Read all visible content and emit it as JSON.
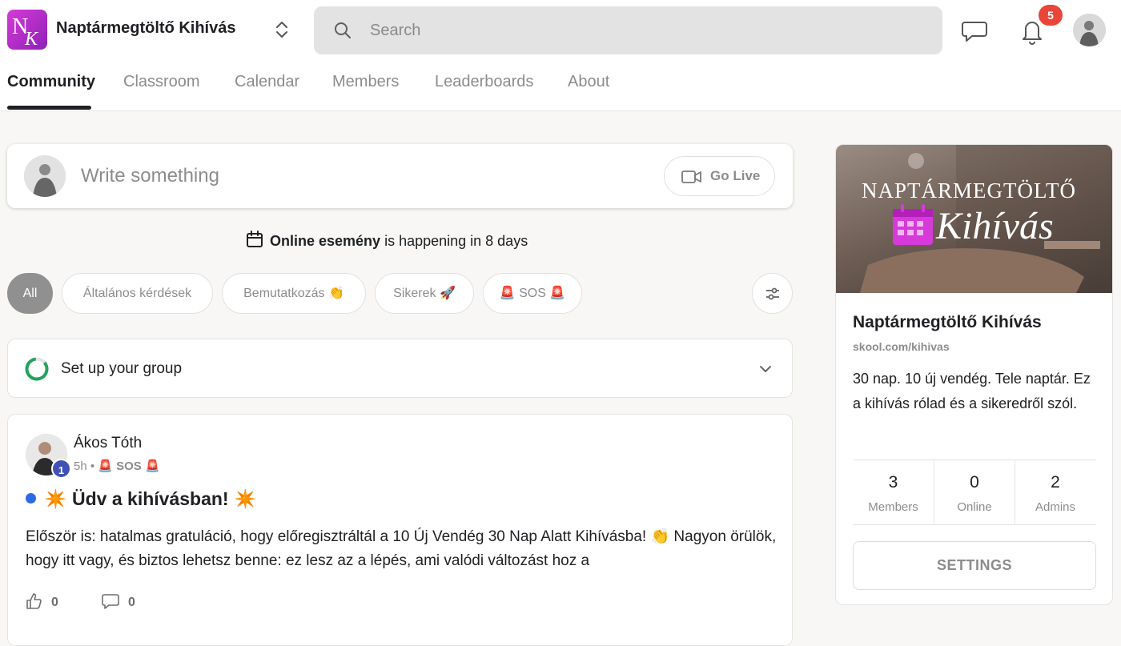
{
  "header": {
    "logo_text": "NK",
    "group_name": "Naptármegtöltő Kihívás",
    "search_placeholder": "Search",
    "notification_count": "5"
  },
  "nav": {
    "tabs": [
      {
        "label": "Community"
      },
      {
        "label": "Classroom"
      },
      {
        "label": "Calendar"
      },
      {
        "label": "Members"
      },
      {
        "label": "Leaderboards"
      },
      {
        "label": "About"
      }
    ],
    "active": "Community"
  },
  "composer": {
    "placeholder": "Write something",
    "go_live_label": "Go Live"
  },
  "event": {
    "name": "Online esemény",
    "suffix": " is happening in 8 days"
  },
  "filters": {
    "chips": [
      {
        "label": "All"
      },
      {
        "label": "Általános kérdések"
      },
      {
        "label": "Bemutatkozás 👏"
      },
      {
        "label": "Sikerek 🚀"
      },
      {
        "label": "🚨 SOS 🚨"
      }
    ],
    "active": "All"
  },
  "setup": {
    "label": "Set up your group"
  },
  "post": {
    "author": "Ákos Tóth",
    "level": "1",
    "time": "5h",
    "separator": " • ",
    "category": "🚨 SOS 🚨",
    "title": "✴️ Üdv a kihívásban! ✴️",
    "body": "Először is: hatalmas gratuláció, hogy előregisztráltál a 10 Új Vendég 30 Nap Alatt Kihívásba! 👏 Nagyon örülök, hogy itt vagy, és biztos lehetsz benne: ez lesz az a lépés, ami valódi változást hoz a",
    "likes": "0",
    "comments": "0"
  },
  "about_card": {
    "banner_line1": "NAPTÁRMEGTÖLTŐ",
    "banner_line2": "Kihívás",
    "title": "Naptármegtöltő Kihívás",
    "url": "skool.com/kihivas",
    "description": "30 nap. 10 új vendég. Tele naptár. Ez a kihívás rólad és a sikeredről szól.",
    "stats": [
      {
        "value": "3",
        "label": "Members"
      },
      {
        "value": "0",
        "label": "Online"
      },
      {
        "value": "2",
        "label": "Admins"
      }
    ],
    "settings_label": "SETTINGS"
  },
  "colors": {
    "logo": "#c833cf",
    "notification_badge": "#e94538",
    "unread_dot": "#2e6ae6",
    "setup_ring": "#21a35b",
    "level_badge": "#3f51b5",
    "banner_accent": "#d63ad8"
  }
}
